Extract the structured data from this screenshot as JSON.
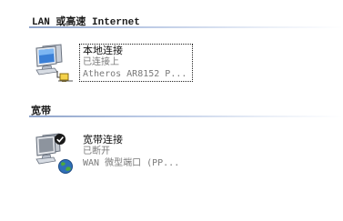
{
  "groups": [
    {
      "title": "LAN 或高速 Internet",
      "connections": [
        {
          "name": "本地连接",
          "status": "已连接上",
          "device": "Atheros AR8152 P...",
          "icon": "lan-connection-icon",
          "selected": true
        }
      ]
    },
    {
      "title": "宽带",
      "connections": [
        {
          "name": "宽带连接",
          "status": "已断开",
          "device": "WAN 微型端口 (PP...",
          "icon": "broadband-connection-icon",
          "selected": false
        }
      ]
    }
  ],
  "colors": {
    "rule": "#8ea3c9",
    "secondary_text": "#7a7a7a"
  }
}
